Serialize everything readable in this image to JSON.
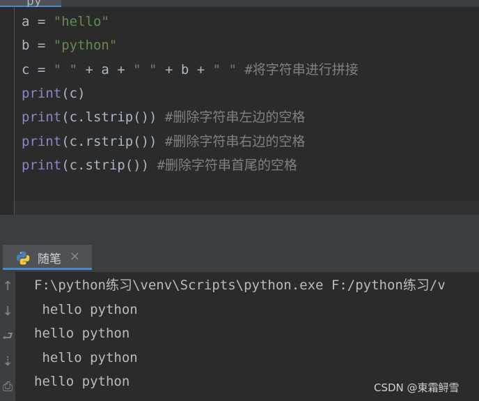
{
  "editor": {
    "tab_fragment": "py",
    "lines": [
      {
        "tokens": [
          {
            "t": "a = ",
            "c": "op"
          },
          {
            "t": "\"hello\"",
            "c": "str"
          }
        ]
      },
      {
        "tokens": [
          {
            "t": "b = ",
            "c": "op"
          },
          {
            "t": "\"python\"",
            "c": "str"
          }
        ]
      },
      {
        "tokens": [
          {
            "t": "c = ",
            "c": "op"
          },
          {
            "t": "\" \"",
            "c": "str"
          },
          {
            "t": " + a + ",
            "c": "op"
          },
          {
            "t": "\" \"",
            "c": "str"
          },
          {
            "t": " + b + ",
            "c": "op"
          },
          {
            "t": "\" \"",
            "c": "str"
          },
          {
            "t": " #将字符串进行拼接",
            "c": "cm"
          }
        ]
      },
      {
        "tokens": [
          {
            "t": "print",
            "c": "kw"
          },
          {
            "t": "(c)",
            "c": "op"
          }
        ]
      },
      {
        "tokens": [
          {
            "t": "print",
            "c": "kw"
          },
          {
            "t": "(c.lstrip()) ",
            "c": "op"
          },
          {
            "t": "#删除字符串左边的空格",
            "c": "cm"
          }
        ]
      },
      {
        "tokens": [
          {
            "t": "print",
            "c": "kw"
          },
          {
            "t": "(c.rstrip()) ",
            "c": "op"
          },
          {
            "t": "#删除字符串右边的空格",
            "c": "cm"
          }
        ]
      },
      {
        "tokens": [
          {
            "t": "print",
            "c": "kw"
          },
          {
            "t": "(c.strip()) ",
            "c": "op"
          },
          {
            "t": "#删除字符串首尾的空格",
            "c": "cm"
          }
        ]
      }
    ]
  },
  "run_panel": {
    "tab_label": "随笔",
    "close_glyph": "×",
    "toolbar_icons": [
      {
        "name": "arrow-up-icon",
        "glyph": "↑"
      },
      {
        "name": "arrow-down-icon",
        "glyph": "↓"
      },
      {
        "name": "soft-wrap-icon",
        "glyph": "⮐"
      },
      {
        "name": "scroll-to-end-icon",
        "glyph": "⇣"
      },
      {
        "name": "print-icon",
        "glyph": "⎙"
      }
    ],
    "output_lines": [
      "F:\\python练习\\venv\\Scripts\\python.exe F:/python练习/v",
      " hello python",
      "hello python",
      " hello python",
      "hello python"
    ]
  },
  "watermark": "CSDN @東霜鲟雪",
  "colors": {
    "background": "#2b2b2b",
    "keyword": "#8888c6",
    "string": "#6a8759",
    "comment": "#808080",
    "text": "#a9b7c6",
    "output": "#bbbbbb",
    "accent": "#4a88c7"
  }
}
